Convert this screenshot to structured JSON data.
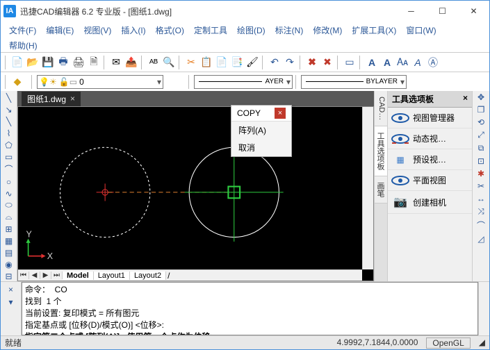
{
  "title": "迅捷CAD编辑器 6.2 专业版  - [图纸1.dwg]",
  "menu": [
    "文件(F)",
    "编辑(E)",
    "视图(V)",
    "插入(I)",
    "格式(O)",
    "定制工具",
    "绘图(D)",
    "标注(N)",
    "修改(M)",
    "扩展工具(X)",
    "窗口(W)",
    "帮助(H)"
  ],
  "doc_tab": "图纸1.dwg",
  "layout_tabs": [
    "Model",
    "Layout1",
    "Layout2"
  ],
  "layer_dd": "0",
  "linew_dd": "BYLAYER",
  "ctx": {
    "header": "COPY",
    "items": [
      "阵列(A)",
      "取消"
    ]
  },
  "panel": {
    "title": "工具选项板",
    "items": [
      "视图管理器",
      "动态视…",
      "预设视…",
      "平面视图",
      "创建相机"
    ]
  },
  "vtabs": [
    "CAD…",
    "工具选项板",
    "画笔"
  ],
  "cmd": {
    "l1": "命令：  CO",
    "l2": "找到  1 个",
    "l3": "当前设置: 复印模式 = 所有图元",
    "l4": "指定基点或 [位移(D)/模式(O)] <位移>:",
    "l5": "指定第二个点或 [阵列(A)] <使用第一个点作为位移>: "
  },
  "status": {
    "left": "就绪",
    "coords": "4.9992,7.1844,0.0000",
    "mode": "OpenGL"
  }
}
